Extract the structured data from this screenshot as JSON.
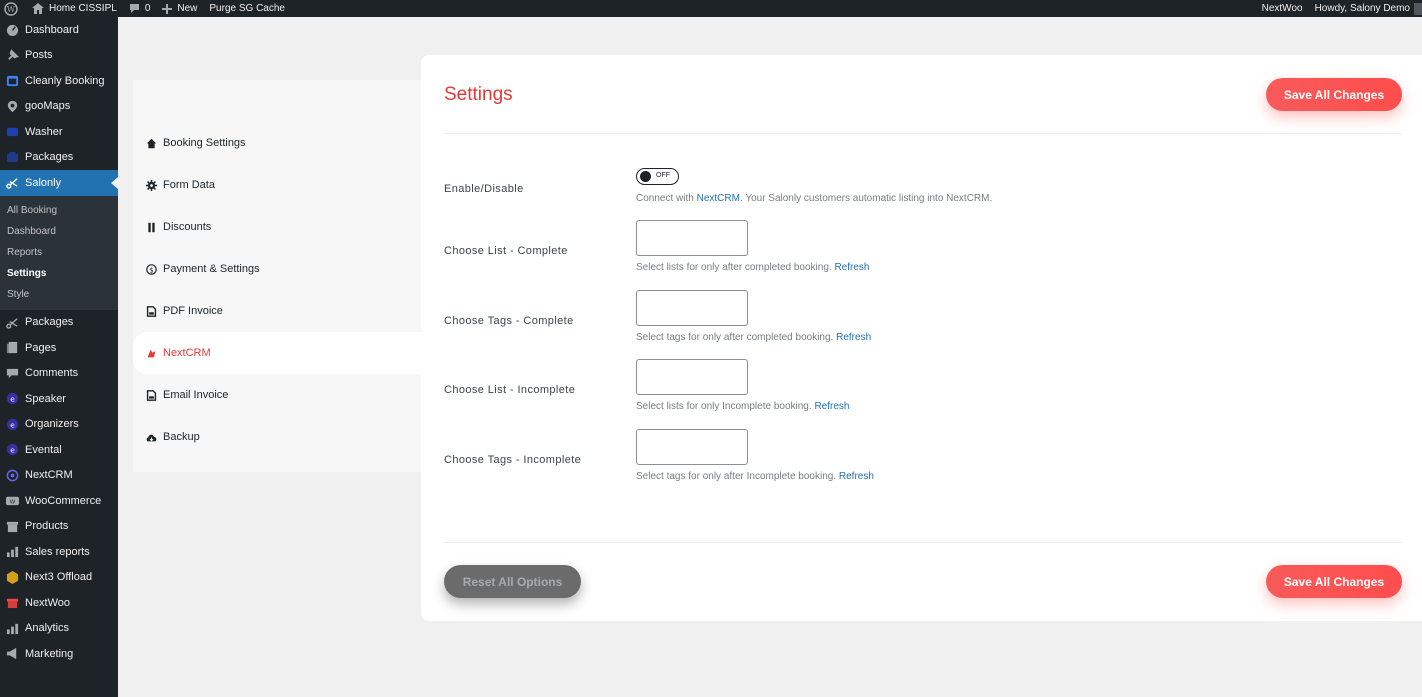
{
  "adminbar": {
    "home": "Home CISSIPL",
    "comments_count": "0",
    "new": "New",
    "purge": "Purge SG Cache",
    "nextwoo": "NextWoo",
    "howdy": "Howdy, Salony Demo"
  },
  "sidebar": {
    "items_top": [
      {
        "label": "Dashboard",
        "icon": "dashboard-icon"
      },
      {
        "label": "Posts",
        "icon": "pin-icon"
      },
      {
        "label": "Cleanly Booking",
        "icon": "booking-icon"
      },
      {
        "label": "gooMaps",
        "icon": "location-icon"
      },
      {
        "label": "Washer",
        "icon": "washer-icon"
      },
      {
        "label": "Packages",
        "icon": "packages-icon"
      },
      {
        "label": "Salonly",
        "icon": "scissors-icon"
      }
    ],
    "submenu": [
      {
        "label": "All Booking"
      },
      {
        "label": "Dashboard"
      },
      {
        "label": "Reports"
      },
      {
        "label": "Settings"
      },
      {
        "label": "Style"
      }
    ],
    "items_bottom": [
      {
        "label": "Packages",
        "icon": "scissors-icon"
      },
      {
        "label": "Pages",
        "icon": "page-icon"
      },
      {
        "label": "Comments",
        "icon": "comment-icon"
      },
      {
        "label": "Speaker",
        "icon": "eventin-icon"
      },
      {
        "label": "Organizers",
        "icon": "eventin-icon"
      },
      {
        "label": "Evental",
        "icon": "eventin-icon"
      },
      {
        "label": "NextCRM",
        "icon": "nextcrm-icon"
      },
      {
        "label": "WooCommerce",
        "icon": "woo-icon"
      },
      {
        "label": "Products",
        "icon": "archive-icon"
      },
      {
        "label": "Sales reports",
        "icon": "chart-icon"
      },
      {
        "label": "Next3 Offload",
        "icon": "next3-icon"
      },
      {
        "label": "NextWoo",
        "icon": "store-icon"
      },
      {
        "label": "Analytics",
        "icon": "chart-icon"
      },
      {
        "label": "Marketing",
        "icon": "megaphone-icon"
      }
    ]
  },
  "settings_nav": [
    {
      "label": "Booking Settings",
      "icon": "home-icon"
    },
    {
      "label": "Form Data",
      "icon": "gear-icon"
    },
    {
      "label": "Discounts",
      "icon": "discount-icon"
    },
    {
      "label": "Payment & Settings",
      "icon": "dollar-icon"
    },
    {
      "label": "PDF Invoice",
      "icon": "document-icon"
    },
    {
      "label": "NextCRM",
      "icon": "nextcrm-icon"
    },
    {
      "label": "Email Invoice",
      "icon": "document-icon"
    },
    {
      "label": "Backup",
      "icon": "cloud-icon"
    }
  ],
  "panel": {
    "title": "Settings",
    "save_label": "Save All Changes",
    "reset_label": "Reset All Options",
    "enable": {
      "label": "Enable/Disable",
      "toggle_text": "OFF",
      "help_prefix": "Connect with ",
      "help_link": "NextCRM",
      "help_suffix": ". Your Salonly customers automatic listing into NextCRM."
    },
    "rows": [
      {
        "label": "Choose List - Complete",
        "help": "Select lists for only after completed booking. ",
        "link": "Refresh"
      },
      {
        "label": "Choose Tags - Complete",
        "help": "Select tags for only after completed booking. ",
        "link": "Refresh"
      },
      {
        "label": "Choose List - Incomplete",
        "help": "Select lists for only Incomplete booking. ",
        "link": "Refresh"
      },
      {
        "label": "Choose Tags - Incomplete",
        "help": "Select tags for only after Incomplete booking. ",
        "link": "Refresh"
      }
    ]
  },
  "colors": {
    "accent": "#e53935",
    "admin_blue": "#2271b1",
    "sidebar_bg": "#1d2327"
  }
}
